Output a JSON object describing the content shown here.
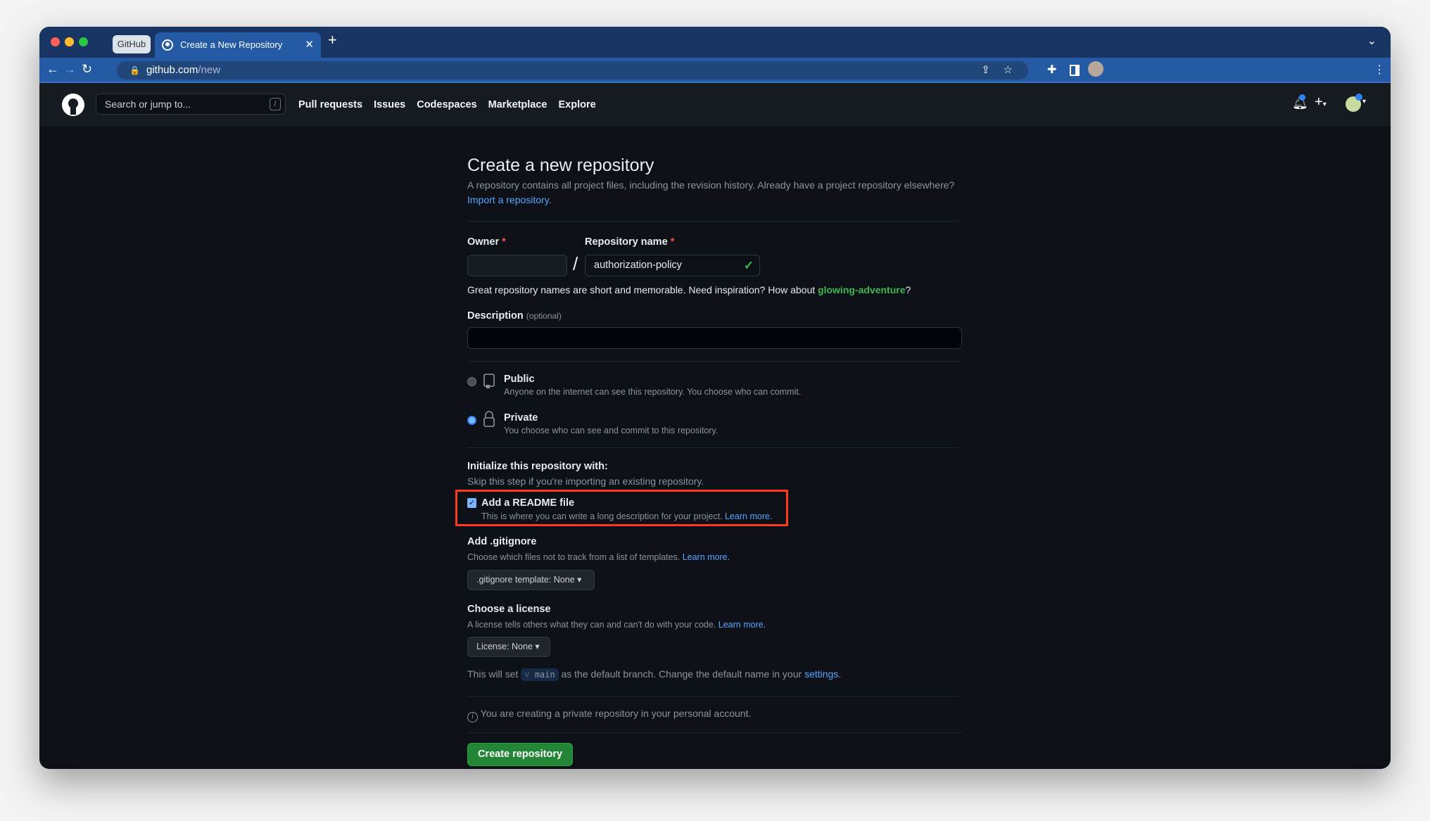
{
  "browser": {
    "pinned_tab": "GitHub",
    "active_tab": "Create a New Repository",
    "url_host": "github.com",
    "url_path": "/new"
  },
  "header": {
    "search_placeholder": "Search or jump to...",
    "search_shortcut": "/",
    "nav": [
      "Pull requests",
      "Issues",
      "Codespaces",
      "Marketplace",
      "Explore"
    ]
  },
  "page": {
    "title": "Create a new repository",
    "intro": "A repository contains all project files, including the revision history. Already have a project repository elsewhere?",
    "import_link": "Import a repository.",
    "owner_label": "Owner",
    "required_mark": "*",
    "owner_value": "",
    "separator": "/",
    "repo_label": "Repository name",
    "repo_value": "authorization-policy",
    "hint": "Great repository names are short and memorable. Need inspiration? How about",
    "suggestion": "glowing-adventure",
    "hint_end": "?",
    "desc_label": "Description",
    "desc_optional": "(optional)",
    "desc_value": "",
    "visibility": [
      {
        "label": "Public",
        "desc": "Anyone on the internet can see this repository. You choose who can commit.",
        "selected": false
      },
      {
        "label": "Private",
        "desc": "You choose who can see and commit to this repository.",
        "selected": true
      }
    ],
    "init_title": "Initialize this repository with:",
    "init_desc": "Skip this step if you're importing an existing repository.",
    "readme_label": "Add a README file",
    "readme_checked": true,
    "readme_desc": "This is where you can write a long description for your project.",
    "learn_more": "Learn more.",
    "gitignore_title": "Add .gitignore",
    "gitignore_desc": "Choose which files not to track from a list of templates.",
    "gitignore_button": ".gitignore template: None",
    "license_title": "Choose a license",
    "license_desc": "A license tells others what they can and can't do with your code.",
    "license_button": "License: None",
    "branch_pre": "This will set",
    "branch_name": "main",
    "branch_post": "as the default branch. Change the default name in your",
    "settings_link": "settings",
    "branch_end": ".",
    "info": "You are creating a private repository in your personal account.",
    "create_button": "Create repository"
  },
  "colors": {
    "accent": "#58a6ff",
    "success": "#238636",
    "highlight": "#ff3b1f",
    "bg": "#0d1117"
  }
}
